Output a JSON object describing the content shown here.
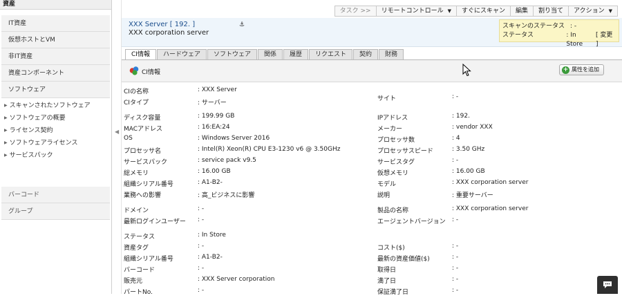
{
  "sidebar": {
    "header": "資産",
    "items": [
      {
        "label": "IT資産"
      },
      {
        "label": "仮想ホストとVM"
      },
      {
        "label": "非IT資産"
      },
      {
        "label": "資産コンポーネント"
      },
      {
        "label": "ソフトウェア"
      }
    ],
    "subitems": [
      {
        "label": "スキャンされたソフトウェア"
      },
      {
        "label": "ソフトウェアの概要"
      },
      {
        "label": "ライセンス契約"
      },
      {
        "label": "ソフトウェアライセンス"
      },
      {
        "label": "サービスパック"
      }
    ],
    "bottom_items": [
      {
        "label": "バーコード"
      },
      {
        "label": "グループ"
      }
    ]
  },
  "actionbar": {
    "tasks": "タスク >>",
    "remote": "リモートコントロール",
    "scan": "すぐにスキャン",
    "edit": "編集",
    "assign": "割り当て",
    "actions": "アクション"
  },
  "header": {
    "title": "XXX Server [ 192.               ]",
    "subtitle": "XXX corporation server",
    "status": {
      "scan_label": "スキャンのステータス",
      "scan_value": ": -",
      "state_label": "ステータス",
      "state_value": ": In Store",
      "change_link": "[ 変更 ]"
    }
  },
  "tabs": [
    "CI情報",
    "ハードウェア",
    "ソフトウェア",
    "関係",
    "履歴",
    "リクエスト",
    "契約",
    "財務"
  ],
  "panel": {
    "title": "CI情報",
    "add_button": "属性を追加"
  },
  "details": [
    {
      "lk": "CIの名称",
      "lv": ": XXX Server",
      "rk": "",
      "rv": ""
    },
    {
      "lk": "CIタイプ",
      "lv": ": サーバー",
      "rk": "サイト",
      "rv": ": -"
    },
    {
      "lk": "ディスク容量",
      "lv": ": 199.99 GB",
      "rk": "IPアドレス",
      "rv": ": 192."
    },
    {
      "lk": "MACアドレス",
      "lv": ": 16:EA:24",
      "rk": "メーカー",
      "rv": ": vendor XXX"
    },
    {
      "lk": "OS",
      "lv": ": Windows Server 2016",
      "rk": "プロセッサ数",
      "rv": ": 4"
    },
    {
      "lk": "プロセッサ名",
      "lv": ": Intel(R) Xeon(R) CPU E3-1230 v6 @ 3.50GHz",
      "rk": "プロセッサスピード",
      "rv": ": 3.50 GHz"
    },
    {
      "lk": "サービスパック",
      "lv": ": service pack v9.5",
      "rk": "サービスタグ",
      "rv": ": -"
    },
    {
      "lk": "総メモリ",
      "lv": ": 16.00 GB",
      "rk": "仮想メモリ",
      "rv": ": 16.00 GB"
    },
    {
      "lk": "組織シリアル番号",
      "lv": ": A1-B2-",
      "rk": "モデル",
      "rv": ": XXX corporation server"
    },
    {
      "lk": "業務への影響",
      "lv": ": 高_ビジネスに影響",
      "rk": "説明",
      "rv": ": 重要サーバー"
    },
    {
      "lk": "ドメイン",
      "lv": ": -",
      "rk": "製品の名称",
      "rv": ": XXX corporation server"
    },
    {
      "lk": "最新ログインユーザー",
      "lv": ": -",
      "rk": "エージェントバージョン",
      "rv": ": -"
    },
    {
      "lk": "ステータス",
      "lv": ": In Store",
      "rk": "",
      "rv": ""
    },
    {
      "lk": "資産タグ",
      "lv": ": -",
      "rk": "コスト($)",
      "rv": ": -"
    },
    {
      "lk": "組織シリアル番号",
      "lv": ": A1-B2-",
      "rk": "最新の資産価値($)",
      "rv": ": -"
    },
    {
      "lk": "バーコード",
      "lv": ": -",
      "rk": "取得日",
      "rv": ": -"
    },
    {
      "lk": "販売元",
      "lv": ": XXX Server corporation",
      "rk": "満了日",
      "rv": ": -"
    },
    {
      "lk": "パートNo.",
      "lv": ": -",
      "rk": "保証満了日",
      "rv": ": -"
    }
  ],
  "colors": {
    "accent": "#1a4d8c",
    "status_bg": "#fbf6c6",
    "header_bg": "#eef5fb"
  }
}
